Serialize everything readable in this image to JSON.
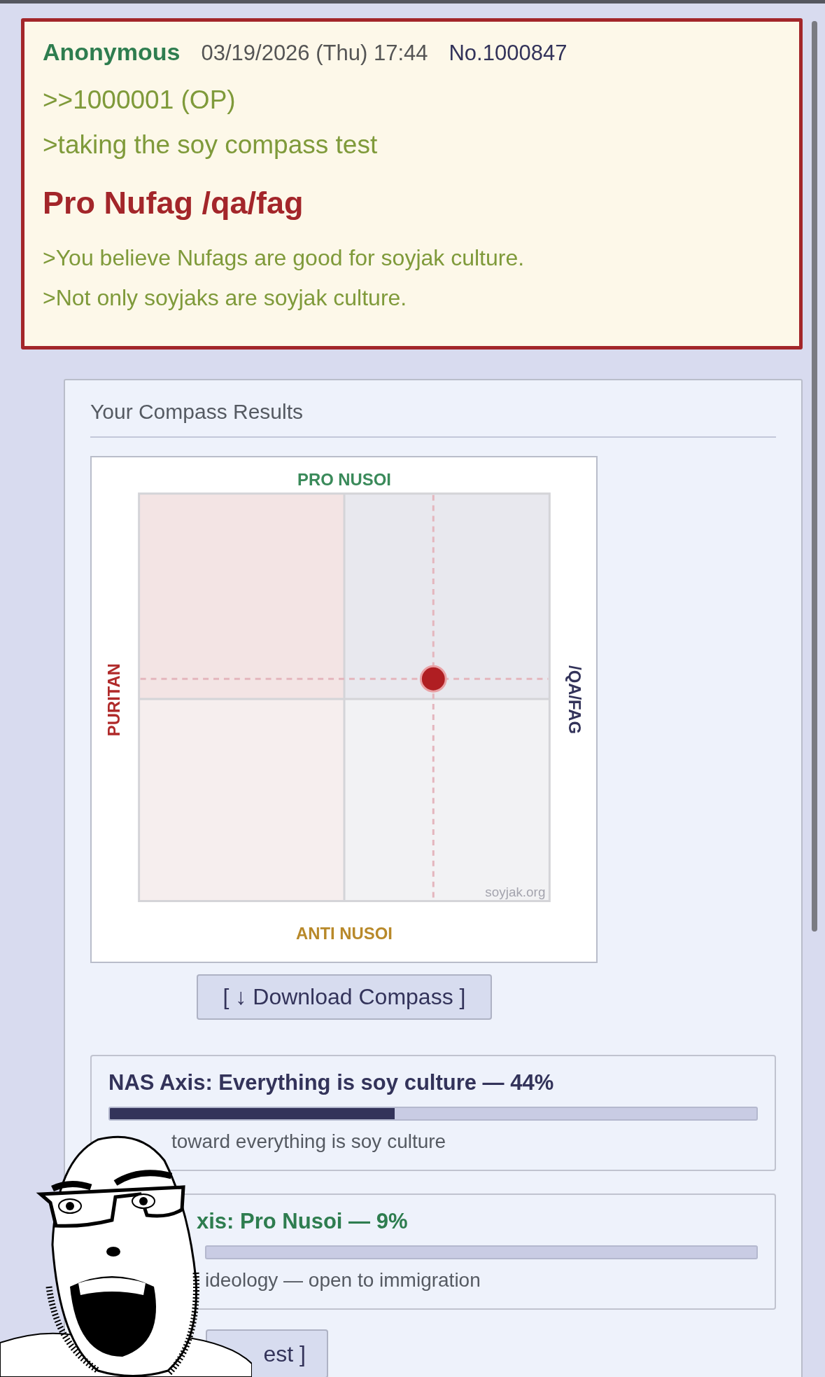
{
  "post": {
    "name": "Anonymous",
    "date": "03/19/2026 (Thu) 17:44",
    "number": "No.1000847",
    "reply_link": ">>1000001 (OP)",
    "greentext": [
      ">taking the soy compass test"
    ],
    "result_title": "Pro Nufag /qa/fag",
    "result_lines": [
      ">You believe Nufags are good for soyjak culture.",
      ">Not only soyjaks are soyjak culture."
    ]
  },
  "results_panel": {
    "heading": "Your Compass Results",
    "compass": {
      "top_label": "PRO NUSOI",
      "bottom_label": "ANTI NUSOI",
      "left_label": "PURITAN",
      "right_label": "/QA/FAG",
      "watermark": "soyjak.org"
    },
    "download_button": "[ ↓ Download Compass ]",
    "axes": [
      {
        "title": "NAS Axis: Everything is soy culture — 44%",
        "color": "#33335a",
        "level": 0.44,
        "description": "toward everything is soy culture"
      },
      {
        "title": "xis: Pro Nusoi — 9%",
        "color": "#2e7d4f",
        "description": "ideology — open to immigration"
      }
    ],
    "bottom_button": "est ]"
  }
}
